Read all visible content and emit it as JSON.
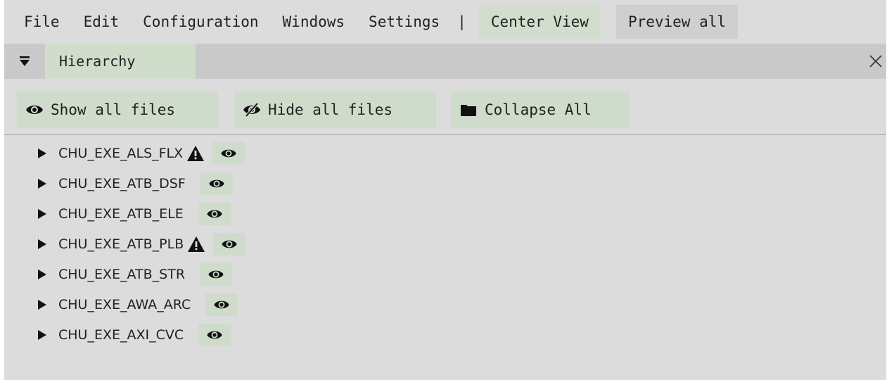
{
  "menubar": {
    "items": [
      "File",
      "Edit",
      "Configuration",
      "Windows",
      "Settings"
    ],
    "separator": "|",
    "center_view": "Center View",
    "preview_all": "Preview all"
  },
  "panel": {
    "tab_label": "Hierarchy",
    "close_icon": "close-icon",
    "collapse_icon": "triangle-down-icon"
  },
  "toolbar": {
    "show_all": "Show all files",
    "hide_all": "Hide all files",
    "collapse_all": "Collapse All"
  },
  "tree": {
    "items": [
      {
        "label": "CHU_EXE_ALS_FLX",
        "warning": true
      },
      {
        "label": "CHU_EXE_ATB_DSF",
        "warning": false
      },
      {
        "label": "CHU_EXE_ATB_ELE",
        "warning": false
      },
      {
        "label": "CHU_EXE_ATB_PLB",
        "warning": true
      },
      {
        "label": "CHU_EXE_ATB_STR",
        "warning": false
      },
      {
        "label": "CHU_EXE_AWA_ARC",
        "warning": false
      },
      {
        "label": "CHU_EXE_AXI_CVC",
        "warning": false
      }
    ]
  },
  "colors": {
    "accent_green": "#d2ddcd",
    "panel_bg": "#dcdcdc",
    "header_bg": "#c9c9c9"
  }
}
